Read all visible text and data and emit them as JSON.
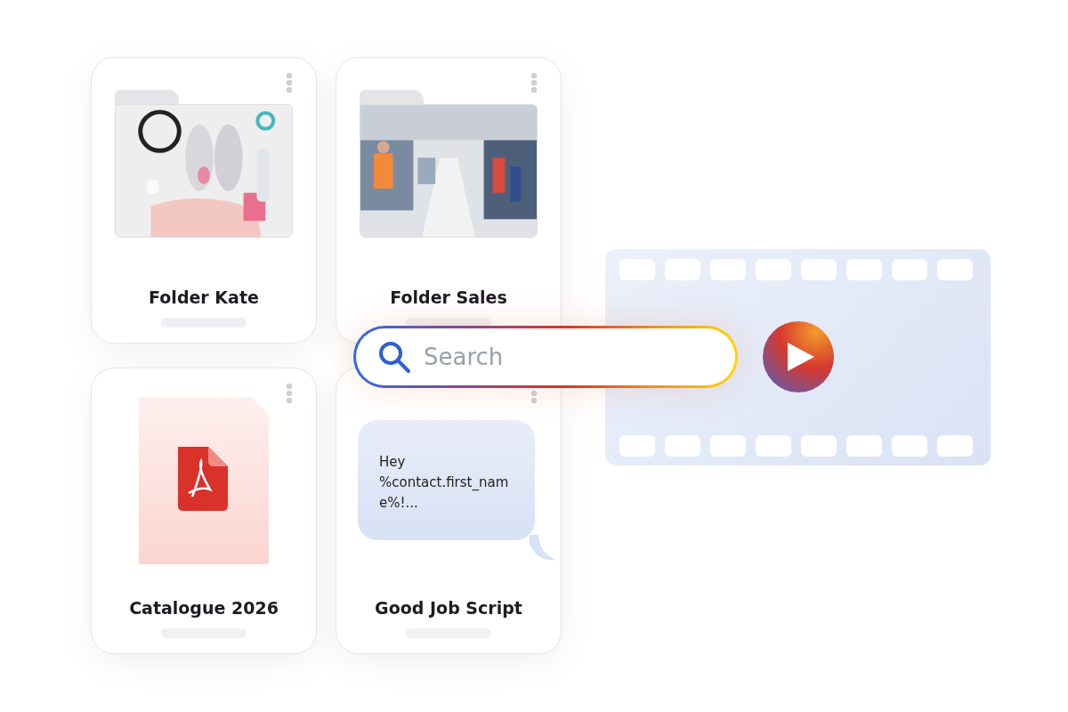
{
  "card_rows": [
    [
      {
        "kind": "folder",
        "title": "Folder Kate"
      },
      {
        "kind": "folder",
        "title": "Folder Sales"
      }
    ],
    [
      {
        "kind": "pdf",
        "title": "Catalogue 2026"
      },
      {
        "kind": "message",
        "title": "Good Job Script",
        "message": "Hey %contact.first_name%!..."
      }
    ]
  ],
  "search": {
    "placeholder": "Search"
  }
}
